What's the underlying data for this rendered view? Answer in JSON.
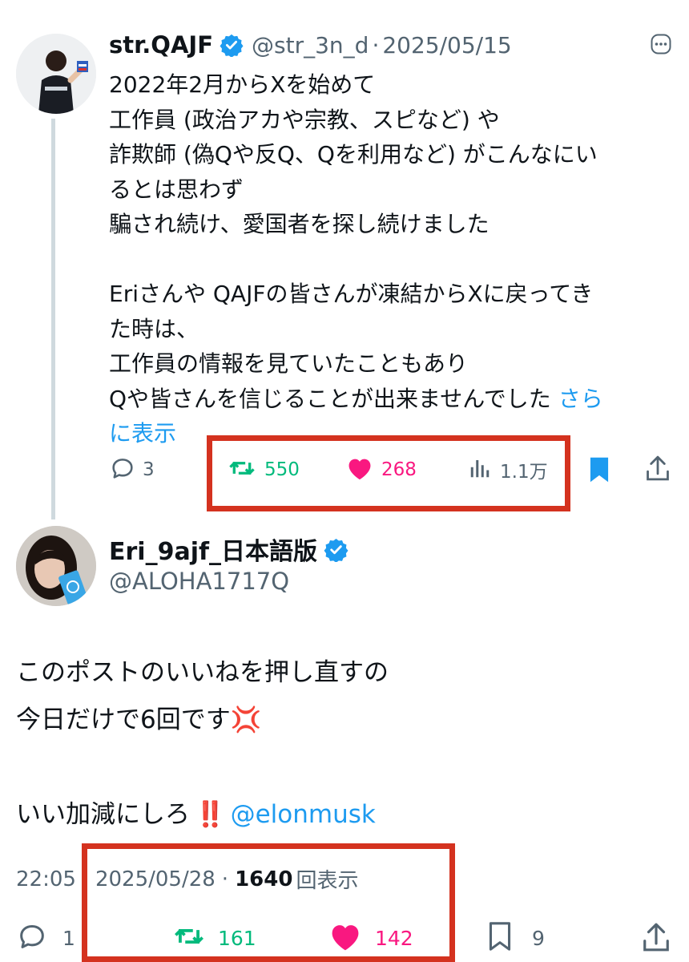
{
  "tweet1": {
    "name": "str.QAJF",
    "handle": "@str_3n_d",
    "sep": "·",
    "date": "2025/05/15",
    "lines": [
      "2022年2月からXを始めて",
      "工作員 (政治アカや宗教、スピなど) や",
      "詐欺師 (偽Qや反Q、Qを利用など) がこんなにい",
      "るとは思わず",
      "騙され続け、愛国者を探し続けました",
      "",
      "Eriさんや QAJFの皆さんが凍結からXに戻ってき",
      "た時は、",
      "工作員の情報を見ていたこともあり",
      "Qや皆さんを信じることが出来ませんでした"
    ],
    "more_a": "さら",
    "more_b": "に表示",
    "replies": "3",
    "retweets": "550",
    "likes": "268",
    "views": "1.1万"
  },
  "tweet2": {
    "name": "Eri_9ajf_日本語版",
    "handle": "@ALOHA1717Q",
    "line1": "このポストのいいねを押し直すの",
    "line2": "今日だけで6回です",
    "anger_emoji": "💢",
    "line3": "いい加減にしろ",
    "bang_emoji": "‼️",
    "mention": "@elonmusk",
    "time": "22:05",
    "date": "2025/05/28",
    "sep": "·",
    "views_count": "1640",
    "views_label": "回表示",
    "replies": "1",
    "retweets": "161",
    "likes": "142",
    "bookmarks": "9"
  },
  "colors": {
    "accent": "#1d9bf0",
    "retweet": "#00ba7c",
    "like": "#f91880",
    "highlight": "#d4321f"
  }
}
